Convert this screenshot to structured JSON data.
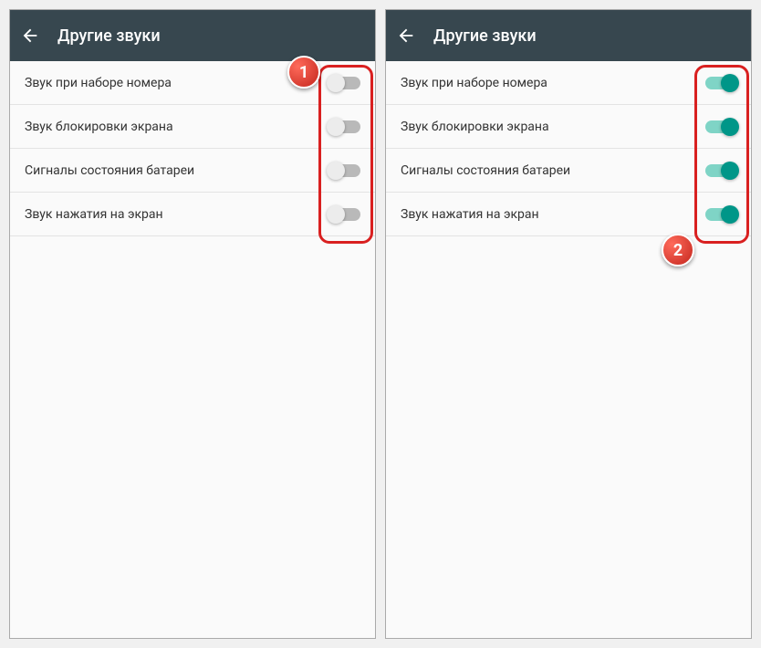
{
  "panels": [
    {
      "title": "Другие звуки",
      "items": [
        {
          "label": "Звук при наборе номера",
          "on": false
        },
        {
          "label": "Звук блокировки экрана",
          "on": false
        },
        {
          "label": "Сигналы состояния батареи",
          "on": false
        },
        {
          "label": "Звук нажатия на экран",
          "on": false
        }
      ],
      "badge": "1"
    },
    {
      "title": "Другие звуки",
      "items": [
        {
          "label": "Звук при наборе номера",
          "on": true
        },
        {
          "label": "Звук блокировки экрана",
          "on": true
        },
        {
          "label": "Сигналы состояния батареи",
          "on": true
        },
        {
          "label": "Звук нажатия на экран",
          "on": true
        }
      ],
      "badge": "2"
    }
  ]
}
